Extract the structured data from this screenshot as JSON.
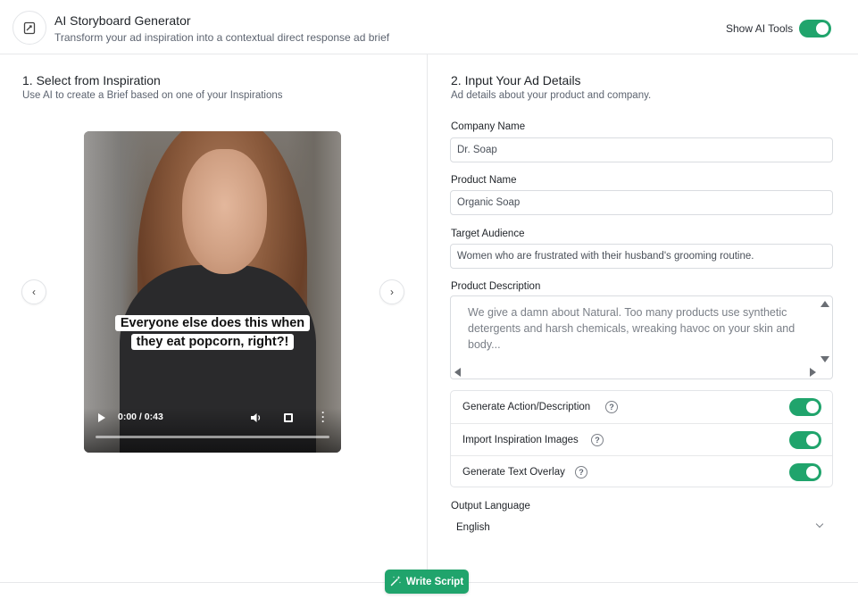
{
  "header": {
    "title": "AI Storyboard Generator",
    "subtitle": "Transform your ad inspiration into a contextual direct response ad brief",
    "logo_icon": "storyboard-icon",
    "tools_label": "Show AI Tools",
    "tools_enabled": true
  },
  "left": {
    "title": "1. Select from Inspiration",
    "subtitle": "Use AI to create a Brief based on one of your Inspirations",
    "prev_icon": "‹",
    "next_icon": "›",
    "video": {
      "caption": "Everyone else does this when they eat popcorn, right?!",
      "time": "0:00 / 0:43",
      "progress": 0
    }
  },
  "right": {
    "title": "2. Input Your Ad Details",
    "subtitle": "Ad details about your product and company.",
    "company": {
      "label": "Company Name",
      "value": "Dr. Soap"
    },
    "product": {
      "label": "Product Name",
      "value": "Organic Soap"
    },
    "audience": {
      "label": "Target Audience",
      "value": "Women who are frustrated with their husband's grooming routine."
    },
    "description": {
      "label": "Product Description",
      "value": "We give a damn about Natural. Too many products use synthetic detergents and harsh chemicals, wreaking havoc on your skin and body..."
    },
    "options": [
      {
        "label": "Generate Action/Description",
        "enabled": true
      },
      {
        "label": "Import Inspiration Images",
        "enabled": true
      },
      {
        "label": "Generate Text Overlay",
        "enabled": true
      }
    ],
    "help_glyph": "?",
    "language": {
      "label": "Output Language",
      "value": "English"
    }
  },
  "footer": {
    "write_label": "Write Script",
    "write_icon": "magic-wand-icon"
  },
  "colors": {
    "accent": "#20a46c",
    "border": "#d9dce0",
    "muted_text": "#5d6470"
  }
}
